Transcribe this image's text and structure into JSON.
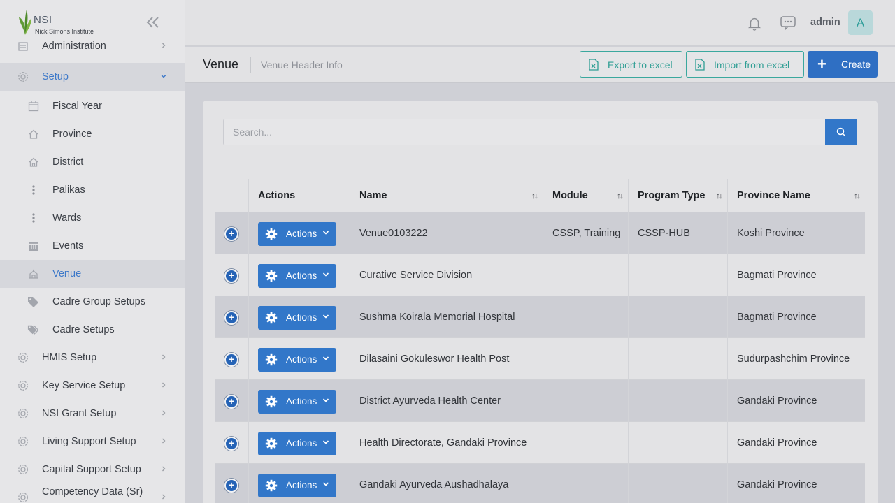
{
  "logo": {
    "abbr": "NSI",
    "name": "Nick Simons Institute"
  },
  "sidebar": {
    "items": [
      {
        "label": "Administration",
        "icon": "admin-icon",
        "level": "top",
        "chevron": true
      },
      {
        "label": "Setup",
        "icon": "gear-icon",
        "level": "top",
        "chevron": true,
        "expanded": true
      },
      {
        "label": "Fiscal Year",
        "icon": "calendar-icon",
        "level": "sub"
      },
      {
        "label": "Province",
        "icon": "home-icon",
        "level": "sub"
      },
      {
        "label": "District",
        "icon": "house-icon",
        "level": "sub"
      },
      {
        "label": "Palikas",
        "icon": "dots-vertical-icon",
        "level": "sub"
      },
      {
        "label": "Wards",
        "icon": "dots-vertical-icon",
        "level": "sub"
      },
      {
        "label": "Events",
        "icon": "calendar-grid-icon",
        "level": "sub"
      },
      {
        "label": "Venue",
        "icon": "venue-icon",
        "level": "sub",
        "active": true
      },
      {
        "label": "Cadre Group Setups",
        "icon": "tag-icon",
        "level": "sub"
      },
      {
        "label": "Cadre Setups",
        "icon": "tags-icon",
        "level": "sub"
      },
      {
        "label": "HMIS Setup",
        "icon": "gear-icon",
        "level": "top",
        "chevron": true
      },
      {
        "label": "Key Service Setup",
        "icon": "gear-icon",
        "level": "top",
        "chevron": true
      },
      {
        "label": "NSI Grant Setup",
        "icon": "gear-icon",
        "level": "top",
        "chevron": true
      },
      {
        "label": "Living Support Setup",
        "icon": "gear-icon",
        "level": "top",
        "chevron": true
      },
      {
        "label": "Capital Support Setup",
        "icon": "gear-icon",
        "level": "top",
        "chevron": true
      },
      {
        "label": "Competency Data (Sr)",
        "icon": "gear-icon",
        "level": "top",
        "chevron": true
      }
    ]
  },
  "topbar": {
    "username": "admin",
    "avatar_letter": "A"
  },
  "page": {
    "title": "Venue",
    "subtitle": "Venue Header Info",
    "export_label": "Export to excel",
    "import_label": "Import from excel",
    "create_label": "Create"
  },
  "search": {
    "placeholder": "Search..."
  },
  "table": {
    "columns": [
      "Actions",
      "Name",
      "Module",
      "Program Type",
      "Province Name"
    ],
    "action_label": "Actions",
    "rows": [
      {
        "name": "Venue0103222",
        "module": "CSSP, Training",
        "program_type": "CSSP-HUB",
        "province": "Koshi Province"
      },
      {
        "name": "Curative Service Division",
        "module": "",
        "program_type": "",
        "province": "Bagmati Province"
      },
      {
        "name": "Sushma Koirala Memorial Hospital",
        "module": "",
        "program_type": "",
        "province": "Bagmati Province"
      },
      {
        "name": "Dilasaini Gokuleswor Health Post",
        "module": "",
        "program_type": "",
        "province": "Sudurpashchim Province"
      },
      {
        "name": "District Ayurveda Health Center",
        "module": "",
        "program_type": "",
        "province": "Gandaki Province"
      },
      {
        "name": "Health Directorate, Gandaki Province",
        "module": "",
        "program_type": "",
        "province": "Gandaki Province"
      },
      {
        "name": "Gandaki Ayurveda Aushadhalaya",
        "module": "",
        "program_type": "",
        "province": "Gandaki Province"
      }
    ]
  },
  "colors": {
    "accent": "#3277c9",
    "teal": "#2f9e94",
    "active_text": "#3e79c9"
  }
}
